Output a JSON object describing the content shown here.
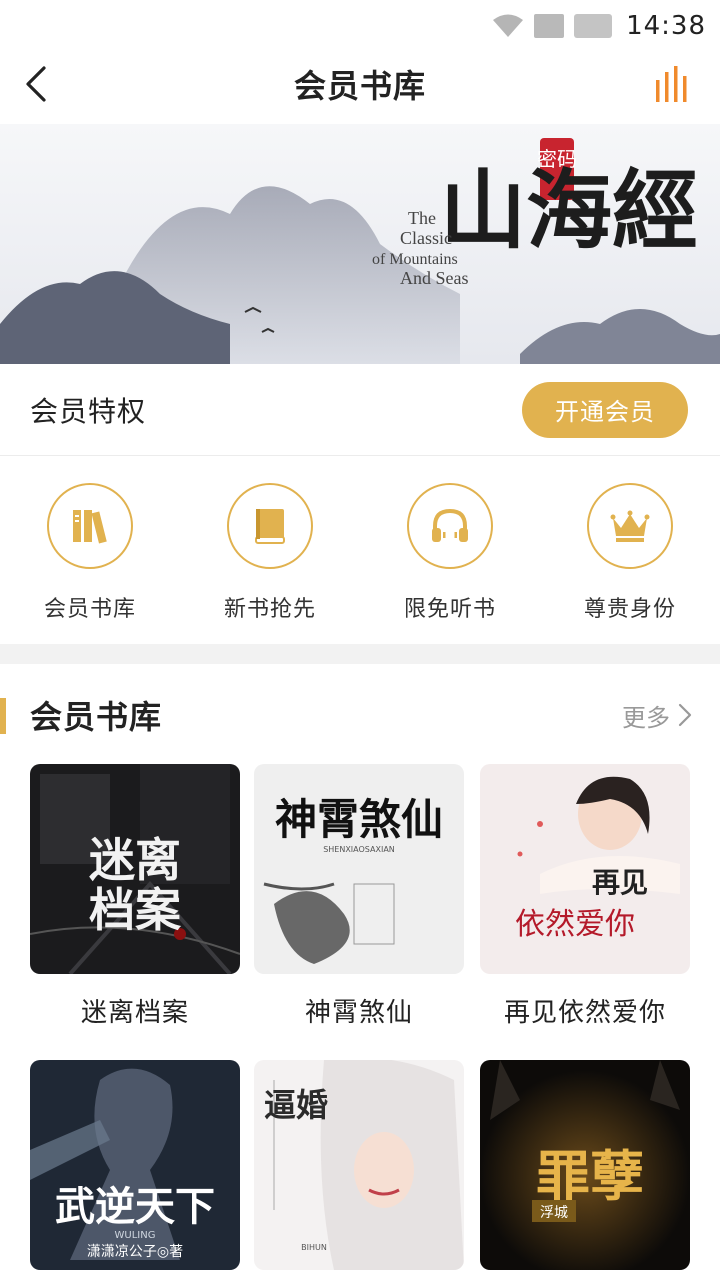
{
  "status_bar": {
    "time": "14:38"
  },
  "nav": {
    "title": "会员书库"
  },
  "banner": {
    "title_cn": "山海經",
    "badge": "密码",
    "title_en_1": "The",
    "title_en_2": "Classic",
    "title_en_3": "of Mountains",
    "title_en_4": "And Seas"
  },
  "privilege": {
    "label": "会员特权",
    "button": "开通会员"
  },
  "features": [
    {
      "label": "会员书库",
      "icon": "books-icon"
    },
    {
      "label": "新书抢先",
      "icon": "book-icon"
    },
    {
      "label": "限免听书",
      "icon": "headphones-icon"
    },
    {
      "label": "尊贵身份",
      "icon": "crown-icon"
    }
  ],
  "section": {
    "title": "会员书库",
    "more": "更多"
  },
  "books": [
    {
      "title": "迷离档案",
      "cover_text": "迷离档案"
    },
    {
      "title": "神霄煞仙",
      "cover_text": "神霄煞仙",
      "cover_sub": "SHENXIAOSAXIAN"
    },
    {
      "title": "再见依然爱你",
      "cover_text_1": "再见",
      "cover_text_2": "依然爱你"
    },
    {
      "cover_text": "武逆天下",
      "cover_sub": "WULING",
      "cover_author": "潇潇凉公子◎著"
    },
    {
      "cover_text": "逼婚",
      "cover_sub": "BIHUN"
    },
    {
      "cover_text": "罪孽",
      "cover_badge": "浮城"
    }
  ],
  "colors": {
    "accent": "#e1b24f",
    "orange": "#f08a2c"
  }
}
